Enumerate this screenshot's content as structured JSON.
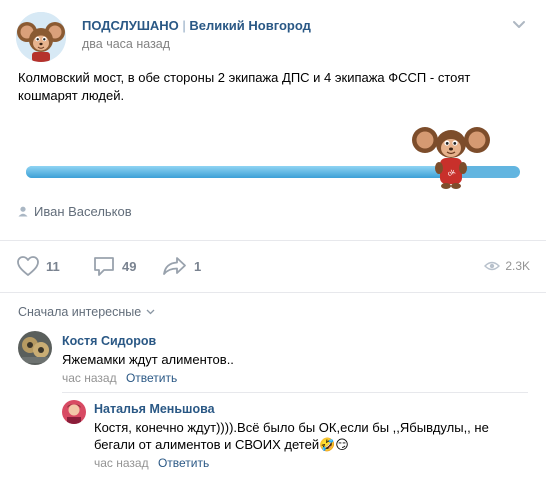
{
  "post": {
    "group_name": "ПОДСЛУШАНО",
    "group_separator": "|",
    "group_city": "Великий Новгород",
    "time": "два часа назад",
    "text": "Колмовский мост, в обе стороны 2 экипажа ДПС и 4 экипажа ФССП - стоят кошмарят людей.",
    "progress_fraction": 0.86,
    "signer": "Иван Васельков",
    "likes": "11",
    "comments_count": "49",
    "shares": "1",
    "views": "2.3K",
    "menu_icon": "chevron-down-icon"
  },
  "comments_sort": "Сначала интересные",
  "comments": [
    {
      "author": "Костя Сидоров",
      "text": "Яжемамки ждут алиментов..",
      "time": "час назад",
      "reply_label": "Ответить"
    },
    {
      "author": "Наталья Меньшова",
      "text": "Костя, конечно ждут)))).Всё было бы ОК,если бы ,,Ябывдулы,, не бегали от алиментов и СВОИХ детей🤣😏",
      "time": "час назад",
      "reply_label": "Ответить"
    }
  ],
  "colors": {
    "link": "#2a5885",
    "meta": "#828282",
    "progress_start": "#8fd4f3",
    "progress_end": "#3ca0d6"
  }
}
